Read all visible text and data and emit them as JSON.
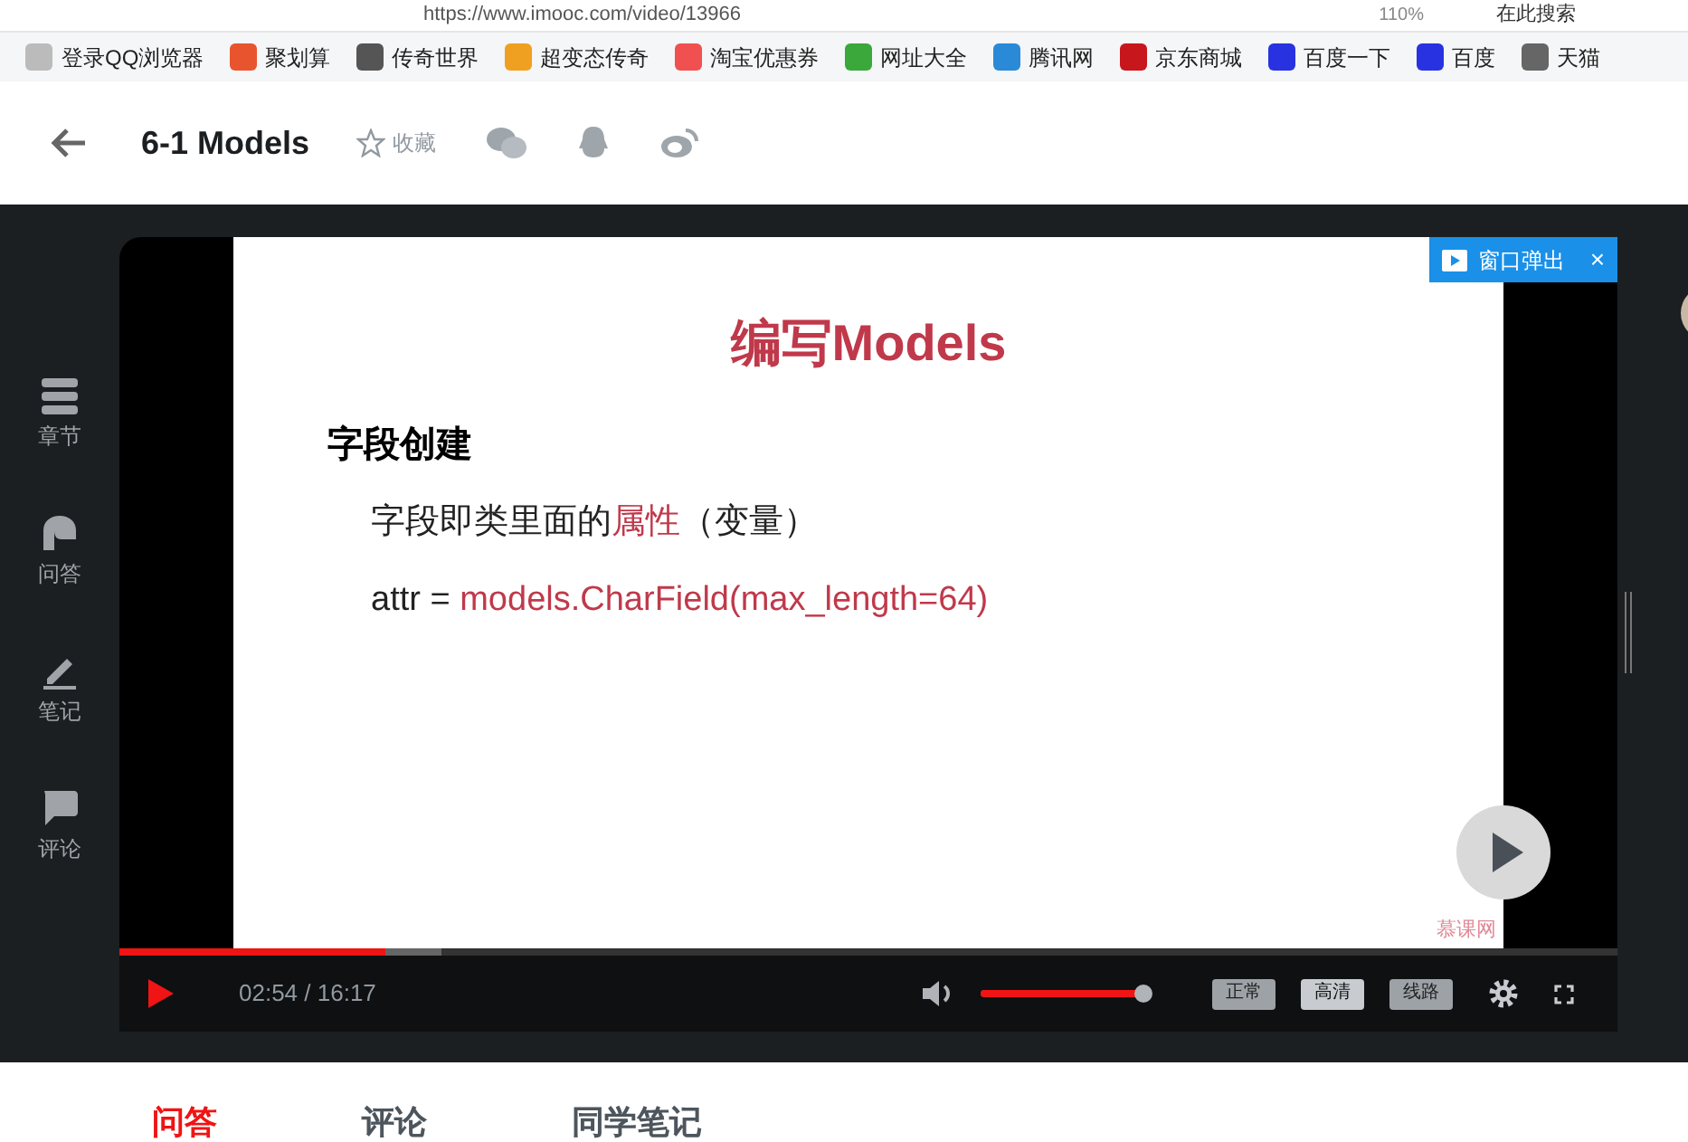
{
  "address_bar": {
    "url": "https://www.imooc.com/video/13966",
    "zoom": "110%",
    "search_placeholder": "在此搜索"
  },
  "bookmarks": [
    {
      "label": "登录QQ浏览器",
      "color": "#bbbbbb"
    },
    {
      "label": "聚划算",
      "color": "#e8542e"
    },
    {
      "label": "传奇世界",
      "color": "#555555"
    },
    {
      "label": "超变态传奇",
      "color": "#f0a020"
    },
    {
      "label": "淘宝优惠券",
      "color": "#f05050"
    },
    {
      "label": "网址大全",
      "color": "#3aa83a"
    },
    {
      "label": "腾讯网",
      "color": "#2a8ad8"
    },
    {
      "label": "京东商城",
      "color": "#c8161d"
    },
    {
      "label": "百度一下",
      "color": "#2932e1"
    },
    {
      "label": "百度",
      "color": "#2932e1"
    },
    {
      "label": "天猫",
      "color": "#666666"
    }
  ],
  "header": {
    "title": "6-1 Models",
    "favorite": "收藏"
  },
  "sidebar": {
    "items": [
      {
        "label": "章节",
        "kind": "chapters"
      },
      {
        "label": "问答",
        "kind": "qa"
      },
      {
        "label": "笔记",
        "kind": "notes"
      },
      {
        "label": "评论",
        "kind": "comments"
      }
    ]
  },
  "player": {
    "popout": "窗口弹出",
    "popout_close": "×",
    "slide": {
      "title": "编写Models",
      "heading": "字段创建",
      "lines": [
        [
          {
            "text": "字段即类里面的",
            "kind": "plain"
          },
          {
            "text": "属性",
            "kind": "highlight"
          },
          {
            "text": "（变量）",
            "kind": "plain"
          }
        ],
        [
          {
            "text": "attr = ",
            "kind": "plain"
          },
          {
            "text": "models.CharField(max_length=64)",
            "kind": "highlight"
          }
        ]
      ],
      "watermark": "慕课网"
    },
    "progress": {
      "level": 0.178
    },
    "buffer": {
      "level": 0.215
    },
    "time": "02:54 / 16:17",
    "volume": {
      "level": 1
    },
    "quality": [
      {
        "label": "正常",
        "selected": false
      },
      {
        "label": "高清",
        "selected": true
      },
      {
        "label": "线路",
        "selected": false
      }
    ]
  },
  "tabs": [
    {
      "label": "问答",
      "selected": true
    },
    {
      "label": "评论",
      "selected": false
    },
    {
      "label": "同学笔记",
      "selected": false
    }
  ]
}
